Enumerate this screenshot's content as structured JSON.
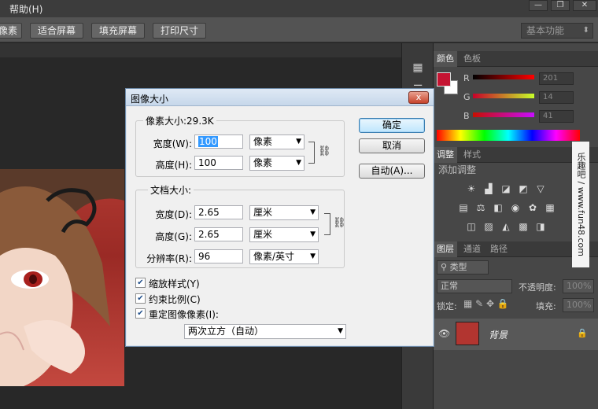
{
  "menu": {
    "help": "帮助(H)"
  },
  "window_controls": {
    "minimize": "—",
    "restore": "❐",
    "close": "✕"
  },
  "options_bar": {
    "buttons": [
      "像素",
      "适合屏幕",
      "填充屏幕",
      "打印尺寸"
    ],
    "workspace": "基本功能"
  },
  "panels": {
    "color_tabs": [
      "颜色",
      "色板"
    ],
    "color_sliders": [
      {
        "label": "R",
        "value": "201"
      },
      {
        "label": "G",
        "value": "14"
      },
      {
        "label": "B",
        "value": "41"
      }
    ],
    "fg_color": "#c51432",
    "adjust_tabs": [
      "调整",
      "样式"
    ],
    "adjust_title": "添加调整",
    "layers_tabs": [
      "图层",
      "通道",
      "路径"
    ],
    "layer_filter": "类型",
    "blend_mode": "正常",
    "opacity_label": "不透明度:",
    "opacity_value": "100%",
    "lock_label": "锁定:",
    "fill_label": "填充:",
    "fill_value": "100%",
    "layer_name": "背景"
  },
  "watermark": "乐趣吧 / www.fun48.com",
  "dialog": {
    "title": "图像大小",
    "close": "x",
    "pixel_size": "像素大小:29.3K",
    "width_label": "宽度(W):",
    "width_value": "100",
    "width_unit": "像素",
    "height_label": "高度(H):",
    "height_value": "100",
    "height_unit": "像素",
    "doc_size": "文档大小:",
    "doc_width_label": "宽度(D):",
    "doc_width_value": "2.65",
    "doc_width_unit": "厘米",
    "doc_height_label": "高度(G):",
    "doc_height_value": "2.65",
    "doc_height_unit": "厘米",
    "resolution_label": "分辨率(R):",
    "resolution_value": "96",
    "resolution_unit": "像素/英寸",
    "scale_styles": "缩放样式(Y)",
    "constrain": "约束比例(C)",
    "resample": "重定图像像素(I):",
    "resample_method": "两次立方（自动）",
    "ok": "确定",
    "cancel": "取消",
    "auto": "自动(A)..."
  }
}
